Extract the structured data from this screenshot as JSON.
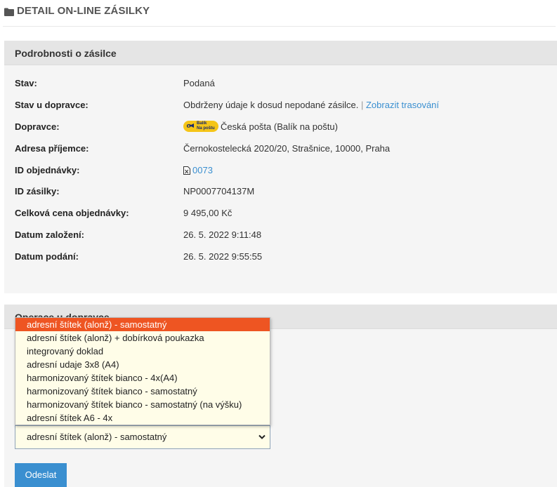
{
  "header": {
    "title": "DETAIL ON-LINE ZÁSILKY"
  },
  "detail": {
    "heading": "Podrobnosti o zásilce",
    "status_label": "Stav:",
    "status_value": "Podaná",
    "carrier_status_label": "Stav u dopravce:",
    "carrier_status_value": "Obdrženy údaje k dosud nepodané zásilce.",
    "carrier_status_separator": "|",
    "tracking_link": "Zobrazit trasování",
    "carrier_label": "Dopravce:",
    "carrier_logo_text": [
      "Balík",
      "Na poštu"
    ],
    "carrier_value": "Česká pošta (Balík na poštu)",
    "address_label": "Adresa příjemce:",
    "address_value": "Černokostelecká 2020/20, Strašnice, 10000, Praha",
    "order_id_label": "ID objednávky:",
    "order_id_value": "0073",
    "shipment_id_label": "ID zásilky:",
    "shipment_id_value": "NP0007704137M",
    "total_label": "Celková cena objednávky:",
    "total_value": "9 495,00 Kč",
    "created_label": "Datum založení:",
    "created_value": "26. 5. 2022 9:11:48",
    "submitted_label": "Datum podání:",
    "submitted_value": "26. 5. 2022 9:55:55"
  },
  "operations": {
    "heading": "Operace u dopravce",
    "options": [
      "adresní štítek (alonž) - samostatný",
      "adresní štítek (alonž) + dobírková poukazka",
      "integrovaný doklad",
      "adresní udaje 3x8 (A4)",
      "harmonizovaný štítek bianco - 4x(A4)",
      "harmonizovaný štítek bianco - samostatný",
      "harmonizovaný štítek bianco - samostatný (na výšku)",
      "adresní štítek A6 - 4x"
    ],
    "selected": "adresní štítek (alonž) - samostatný",
    "submit_label": "Odeslat"
  },
  "colors": {
    "accent": "#3a8fd0",
    "highlight": "#ee5522",
    "carrier_logo": "#f5c518"
  }
}
